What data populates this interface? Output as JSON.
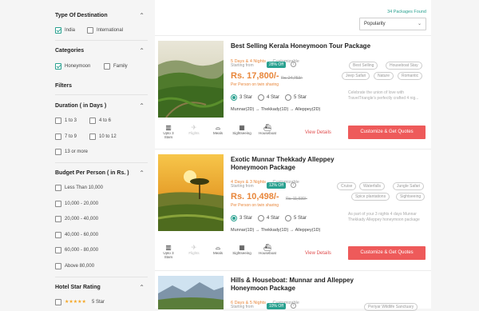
{
  "filters": {
    "destination": {
      "title": "Type Of Destination",
      "options": [
        {
          "label": "India",
          "checked": true
        },
        {
          "label": "International",
          "checked": false
        }
      ]
    },
    "categories": {
      "title": "Categories",
      "options": [
        {
          "label": "Honeymoon",
          "checked": true
        },
        {
          "label": "Family",
          "checked": false
        }
      ]
    },
    "heading": "Filters",
    "duration": {
      "title": "Duration ( in Days )",
      "options": [
        "1 to 3",
        "4 to 6",
        "7 to 9",
        "10 to 12",
        "13 or more"
      ]
    },
    "budget": {
      "title": "Budget Per Person ( in Rs. )",
      "options": [
        "Less Than 10,000",
        "10,000 - 20,000",
        "20,000 - 40,000",
        "40,000 - 60,000",
        "60,000 - 80,000",
        "Above 80,000"
      ]
    },
    "hotel": {
      "title": "Hotel Star Rating",
      "options": [
        {
          "stars": "★★★★★",
          "label": "5 Star"
        }
      ]
    }
  },
  "results": {
    "count": "34 Packages Found",
    "sort": "Popularity"
  },
  "cards": [
    {
      "title_line1": "Best Selling Kerala Honeymoon Tour Package",
      "title_line2": "",
      "duration": "5 Days & 4 Nights",
      "customizable": "Customizable",
      "starting_from": "Starting from",
      "discount": "28% Off",
      "price": "Rs. 17,800/-",
      "old_price": "Rs. 24,753/-",
      "per_person": "Per Person on twin sharing",
      "stars": [
        "3 Star",
        "4 Star",
        "5 Star"
      ],
      "route": "Munnar(2D)  →  Thekkady(1D)  →  Alleppey(2D)",
      "tags": [
        "Best Selling",
        "Houseboat Stay",
        "Jeep Safari",
        "Nature",
        "Romantic"
      ],
      "desc": "Celebrate the union of love with TravelTriangle's perfectly crafted 4 nig...",
      "amenities": [
        "Upto 3 Stars",
        "Flights",
        "Meals",
        "Sightseeing",
        "Houseboat"
      ],
      "view": "View Details",
      "cta": "Customize & Get Quotes"
    },
    {
      "title_line1": "Exotic Munnar Thekkady Alleppey",
      "title_line2": "Honeymoon Package",
      "duration": "4 Days & 3 Nights",
      "customizable": "Customizable",
      "starting_from": "Starting from",
      "discount": "12% Off",
      "price": "Rs. 10,498/-",
      "old_price": "Rs. 11,930/-",
      "per_person": "Per Person on twin sharing",
      "stars": [
        "3 Star",
        "4 Star",
        "5 Star"
      ],
      "route": "Munnar(1D)  →  Thekkady(1D)  →  Alleppey(1D)",
      "tags": [
        "Cruise",
        "Waterfalls",
        "Jungle Safari",
        "Spice plantations",
        "Sightseeing"
      ],
      "desc": "As part of your 3 nights 4 days Munnar Thekkady Alleppey honeymoon package",
      "amenities": [
        "Upto 3 Stars",
        "Flights",
        "Meals",
        "Sightseeing",
        "Houseboat"
      ],
      "view": "View Details",
      "cta": "Customize & Get Quotes"
    },
    {
      "title_line1": "Hills & Houseboat: Munnar and Alleppey",
      "title_line2": "Honeymoon Package",
      "duration": "6 Days & 5 Nights",
      "customizable": "Customizable",
      "starting_from": "Starting from",
      "discount": "10% Off",
      "tags": [
        "Periyar Wildlife Sanctuary"
      ]
    }
  ]
}
